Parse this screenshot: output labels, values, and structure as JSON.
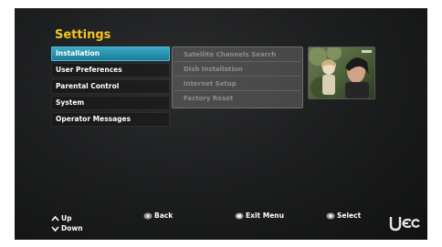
{
  "screen": {
    "title": "Settings"
  },
  "menu": {
    "items": [
      {
        "label": "Installation"
      },
      {
        "label": "User Preferences"
      },
      {
        "label": "Parental Control"
      },
      {
        "label": "System"
      },
      {
        "label": "Operator Messages"
      }
    ],
    "selected": "Installation"
  },
  "submenu": {
    "items": [
      {
        "label": "Satellite Channels Search"
      },
      {
        "label": "Dish Installation"
      },
      {
        "label": "Internet Setup"
      },
      {
        "label": "Factory Reset"
      }
    ]
  },
  "preview": {
    "description_icon": "tv-preview-thumbnail"
  },
  "footer": {
    "up_label": "Up",
    "down_label": "Down",
    "back_label": "Back",
    "exit_label": "Exit Menu",
    "select_label": "Select",
    "logo_text": "UEC"
  },
  "colors": {
    "title": "#f3c51f",
    "selected_item": "#2592b0",
    "background": "#1c1d1e"
  }
}
